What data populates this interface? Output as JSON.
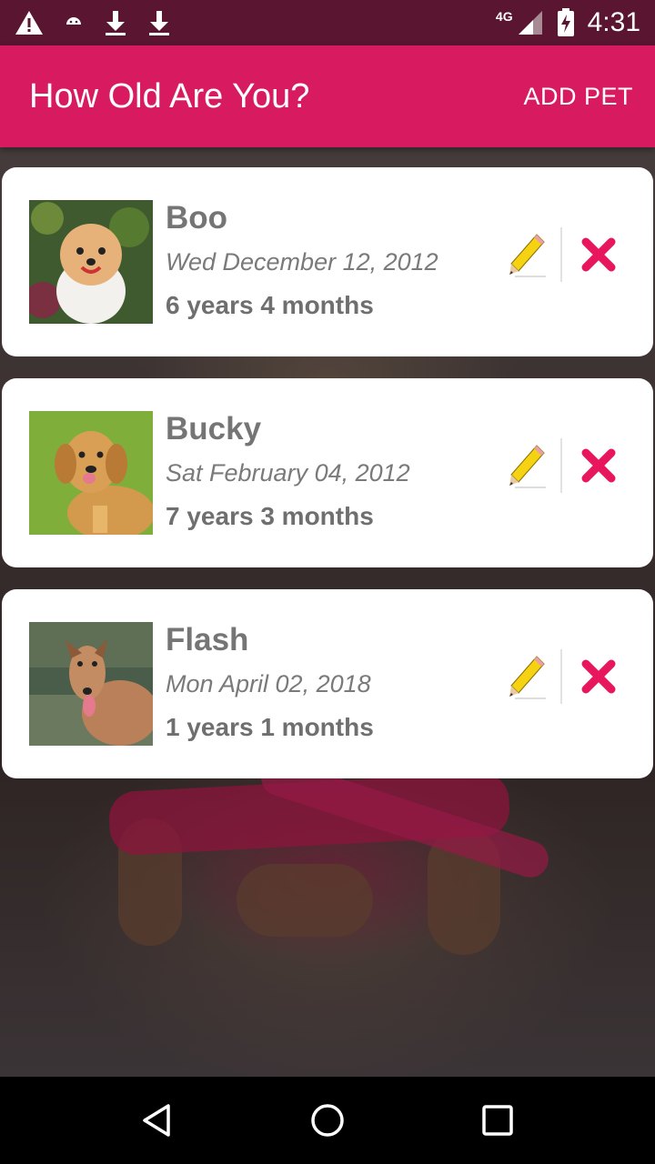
{
  "status_bar": {
    "time": "4:31",
    "network": "4G",
    "icons": [
      "warning-icon",
      "android-icon",
      "download-icon",
      "download-icon",
      "signal-icon",
      "battery-charging-icon"
    ]
  },
  "app_bar": {
    "title": "How Old Are You?",
    "action_label": "ADD PET",
    "color": "#D81B60"
  },
  "pets": [
    {
      "name": "Boo",
      "birth_date": "Wed December 12, 2012",
      "age": "6 years 4 months"
    },
    {
      "name": "Bucky",
      "birth_date": "Sat February 04, 2012",
      "age": "7 years 3 months"
    },
    {
      "name": "Flash",
      "birth_date": "Mon April 02, 2018",
      "age": "1 years 1 months"
    }
  ],
  "nav_bar": {
    "buttons": [
      "back-icon",
      "home-icon",
      "recents-icon"
    ]
  },
  "colors": {
    "status_bar": "#5A1530",
    "delete": "#E8175D",
    "pencil": "#F5D312"
  }
}
